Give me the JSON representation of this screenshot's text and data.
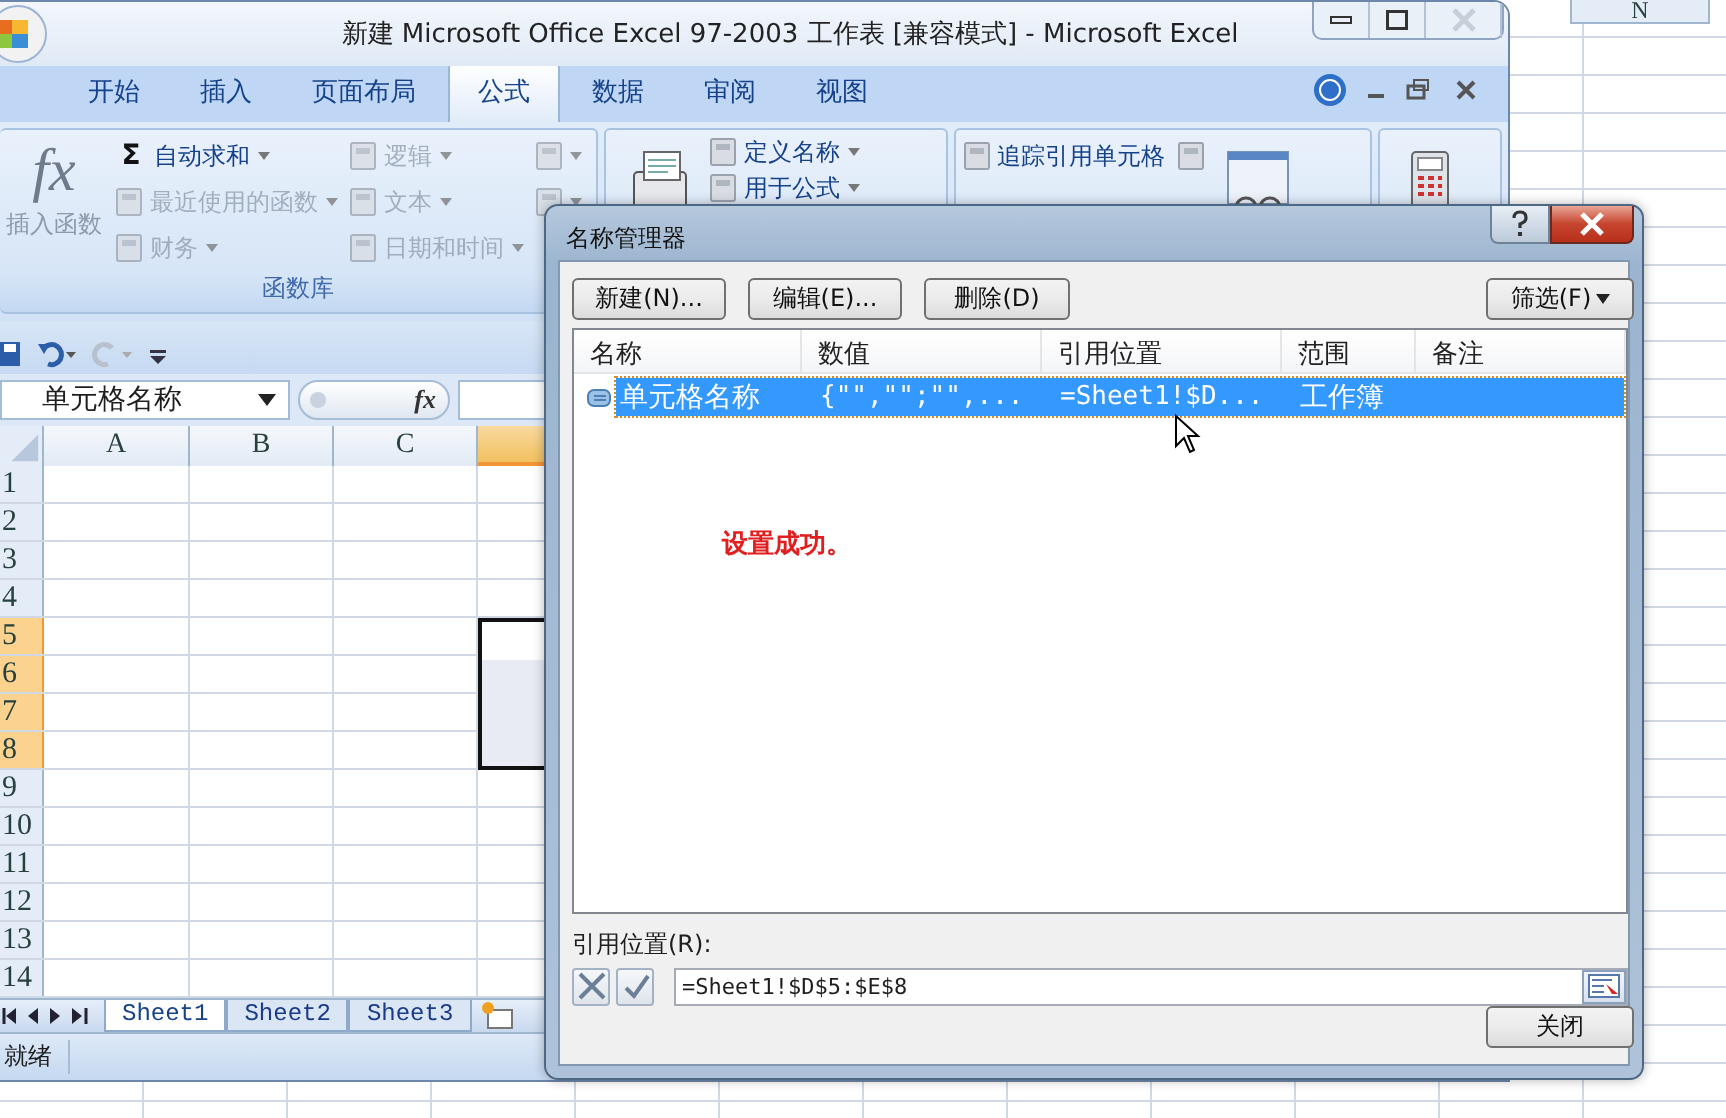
{
  "background_sheet": {
    "column_header": "N"
  },
  "excel": {
    "title": "新建 Microsoft Office Excel 97-2003 工作表  [兼容模式] - Microsoft Excel",
    "ribbon_tabs": [
      {
        "label": "开始",
        "selected": false
      },
      {
        "label": "插入",
        "selected": false
      },
      {
        "label": "页面布局",
        "selected": false
      },
      {
        "label": "公式",
        "selected": true
      },
      {
        "label": "数据",
        "selected": false
      },
      {
        "label": "审阅",
        "selected": false
      },
      {
        "label": "视图",
        "selected": false
      }
    ],
    "ribbon_groups": [
      {
        "label": "函数库",
        "columns": [
          {
            "items": [
              {
                "kind": "large",
                "symbol": "fx",
                "label": "插入函数",
                "disabled": true
              }
            ]
          },
          {
            "items": [
              {
                "kind": "small",
                "symbol": "Σ",
                "label": "自动求和",
                "dropdown": true,
                "disabled": false
              },
              {
                "kind": "small",
                "label": "最近使用的函数",
                "dropdown": true,
                "disabled": true
              },
              {
                "kind": "small",
                "label": "财务",
                "dropdown": true,
                "disabled": true
              }
            ]
          },
          {
            "items": [
              {
                "kind": "small",
                "label": "逻辑",
                "dropdown": true,
                "disabled": true
              },
              {
                "kind": "small",
                "label": "文本",
                "dropdown": true,
                "disabled": true
              },
              {
                "kind": "small",
                "label": "日期和时间",
                "dropdown": true,
                "disabled": true
              }
            ]
          },
          {
            "items": [
              {
                "kind": "icon",
                "dropdown": true,
                "disabled": true
              },
              {
                "kind": "icon",
                "dropdown": true,
                "disabled": true
              }
            ]
          }
        ]
      },
      {
        "columns": [
          {
            "items": [
              {
                "kind": "icon-large",
                "disabled": false
              }
            ]
          },
          {
            "items": [
              {
                "kind": "small",
                "label": "定义名称",
                "dropdown": true,
                "disabled": false
              },
              {
                "kind": "small",
                "label": "用于公式",
                "dropdown": true,
                "disabled": false
              }
            ]
          }
        ]
      },
      {
        "columns": [
          {
            "items": [
              {
                "kind": "small",
                "label": "追踪引用单元格",
                "disabled": false
              }
            ]
          },
          {
            "items": [
              {
                "kind": "icon",
                "disabled": false
              }
            ]
          },
          {
            "items": [
              {
                "kind": "icon-large",
                "disabled": false
              }
            ]
          }
        ]
      },
      {
        "columns": [
          {
            "items": [
              {
                "kind": "icon-large",
                "disabled": false
              }
            ]
          }
        ]
      }
    ],
    "name_box": "单元格名称",
    "formula_symbol": "fx",
    "columns": [
      {
        "label": "A",
        "selected": false
      },
      {
        "label": "B",
        "selected": false
      },
      {
        "label": "C",
        "selected": false
      },
      {
        "selected": true
      }
    ],
    "rows": [
      {
        "label": "1",
        "selected": false
      },
      {
        "label": "2",
        "selected": false
      },
      {
        "label": "3",
        "selected": false
      },
      {
        "label": "4",
        "selected": false
      },
      {
        "label": "5",
        "selected": true
      },
      {
        "label": "6",
        "selected": true
      },
      {
        "label": "7",
        "selected": true
      },
      {
        "label": "8",
        "selected": true
      },
      {
        "label": "9",
        "selected": false
      },
      {
        "label": "10",
        "selected": false
      },
      {
        "label": "11",
        "selected": false
      },
      {
        "label": "12",
        "selected": false
      },
      {
        "label": "13",
        "selected": false
      },
      {
        "label": "14",
        "selected": false
      }
    ],
    "sheet_tabs": [
      {
        "label": "Sheet1",
        "selected": true
      },
      {
        "label": "Sheet2",
        "selected": false
      },
      {
        "label": "Sheet3",
        "selected": false
      }
    ],
    "status_bar": "就绪"
  },
  "dialog": {
    "title": "名称管理器",
    "buttons": [
      "新建(N)...",
      "编辑(E)...",
      "删除(D)"
    ],
    "filter_button": "筛选(F)",
    "list": {
      "columns": [
        "名称",
        "数值",
        "引用位置",
        "范围",
        "备注"
      ],
      "rows": [
        {
          "cells": [
            "单元格名称",
            "{\"\",\"\";\"\",...",
            "=Sheet1!$D...",
            "工作簿"
          ],
          "selected": true
        }
      ]
    },
    "annotation": "设置成功。",
    "refers_to": {
      "label": "引用位置(R):",
      "value": "=Sheet1!$D$5:$E$8"
    },
    "close_button": "关闭"
  }
}
